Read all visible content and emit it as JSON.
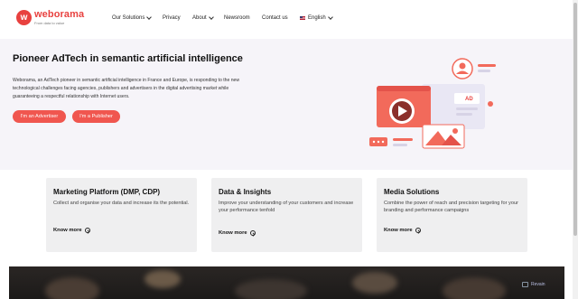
{
  "header": {
    "logo": {
      "name": "weborama",
      "tagline": "From data to value"
    },
    "nav": [
      {
        "label": "Our Solutions",
        "has_dropdown": true
      },
      {
        "label": "Privacy",
        "has_dropdown": false
      },
      {
        "label": "About",
        "has_dropdown": true
      },
      {
        "label": "Newsroom",
        "has_dropdown": false
      },
      {
        "label": "Contact us",
        "has_dropdown": false
      },
      {
        "label": "English",
        "has_dropdown": true,
        "icon": "us-flag-icon"
      }
    ]
  },
  "hero": {
    "title": "Pioneer AdTech in semantic artificial intelligence",
    "description": "Weborama, an AdTech pioneer in semantic artificial intelligence in France and Europe, is responding to the new technological challenges facing agencies, publishers and advertisers in the digital advertising market while guaranteeing a respectful relationship with Internet users.",
    "buttons": [
      {
        "label": "I'm an Advertiser"
      },
      {
        "label": "I'm a Publisher"
      }
    ],
    "illustration": {
      "ad_label": "AD"
    }
  },
  "cards": [
    {
      "title": "Marketing Platform (DMP, CDP)",
      "text": "Collect and organise your data and increase its the potential.",
      "link": "Know more"
    },
    {
      "title": "Data & Insights",
      "text": "Improve your understanding of your customers and increase your performance tenfold",
      "link": "Know more"
    },
    {
      "title": "Media Solutions",
      "text": "Combine the power of reach and precision targeting for your branding and performance campaigns",
      "link": "Know more"
    }
  ],
  "watermark": {
    "text": "Revain"
  },
  "colors": {
    "brand": "#e8413f",
    "button": "#f0564f",
    "hero_bg": "#f6f4f9",
    "card_bg": "#efeff0"
  }
}
